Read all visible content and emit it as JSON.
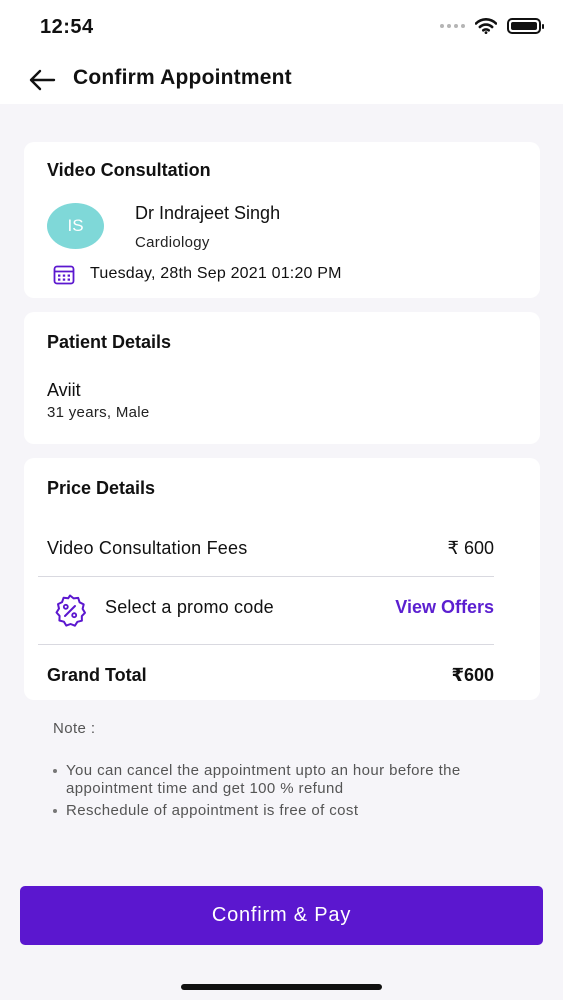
{
  "status_bar": {
    "time": "12:54"
  },
  "header": {
    "title": "Confirm Appointment"
  },
  "consultation": {
    "title": "Video Consultation",
    "doctor_initials": "IS",
    "doctor_name": "Dr Indrajeet Singh",
    "specialty": "Cardiology",
    "datetime": "Tuesday, 28th Sep 2021 01:20 PM"
  },
  "patient": {
    "title": "Patient Details",
    "name": "Aviit",
    "meta": "31 years, Male"
  },
  "price": {
    "title": "Price Details",
    "fee_label": "Video Consultation Fees",
    "fee_value": "₹ 600",
    "promo_label": "Select a promo code",
    "view_offers": "View Offers",
    "total_label": "Grand Total",
    "total_value": "₹600"
  },
  "note": {
    "title": "Note :",
    "items": [
      "You can cancel the appointment upto an hour before the appointment time and get 100 % refund",
      "Reschedule of appointment is free of cost"
    ]
  },
  "confirm_button": "Confirm & Pay",
  "colors": {
    "accent": "#5b17cf",
    "avatar": "#7fd8d8",
    "link": "#5b1fd0",
    "background": "#f6f5f9"
  },
  "icons": [
    "wifi-icon",
    "battery-icon",
    "back-arrow-icon",
    "calendar-icon",
    "promo-badge-icon"
  ]
}
